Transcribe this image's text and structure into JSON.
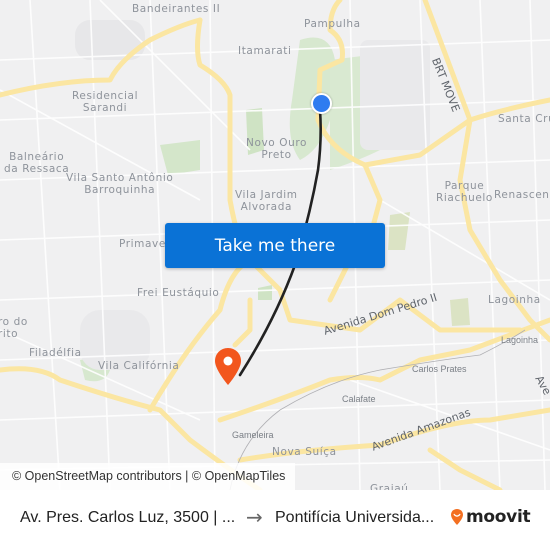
{
  "map": {
    "neighborhood_labels": [
      "Bandeirantes II",
      "Pampulha",
      "Itamarati",
      "Residencial\nSarandi",
      "Santa Cruz",
      "Balneário\nda Ressaca",
      "Vila Santo Antônio\nBarroquinha",
      "Novo Ouro\nPreto",
      "Vila Jardim\nAlvorada",
      "Parque\nRiachuelo",
      "Renascença",
      "Primavera",
      "Frei Eustáquio",
      "Lagoinha",
      "ro do\nrito",
      "Filadélfia",
      "Vila Califórnia",
      "Nova Suíça",
      "Grajaú"
    ],
    "small_labels": [
      "Lagoinha",
      "Carlos Prates",
      "Calafate",
      "Gameleira"
    ],
    "road_labels": [
      "BRT MOVE",
      "Avenida Dom Pedro II",
      "Avenida Amazonas",
      "Ave"
    ],
    "colors": {
      "background": "#f0f0f1",
      "road_major": "#fbe6a2",
      "park": "#cfe3c4",
      "route": "#222222",
      "origin_pin": "#2f7cf0",
      "destination_pin": "#f2561d",
      "button": "#0a72d6"
    },
    "origin_icon": "origin-dot-icon",
    "destination_icon": "destination-pin-icon"
  },
  "cta": {
    "label": "Take me there"
  },
  "attribution": "© OpenStreetMap contributors | © OpenMapTiles",
  "footer": {
    "from": "Av. Pres. Carlos Luz, 3500 | ...",
    "arrow": "→",
    "to": "Pontifícia Universida...",
    "brand": "moovit",
    "brand_color": "#f36f21"
  }
}
